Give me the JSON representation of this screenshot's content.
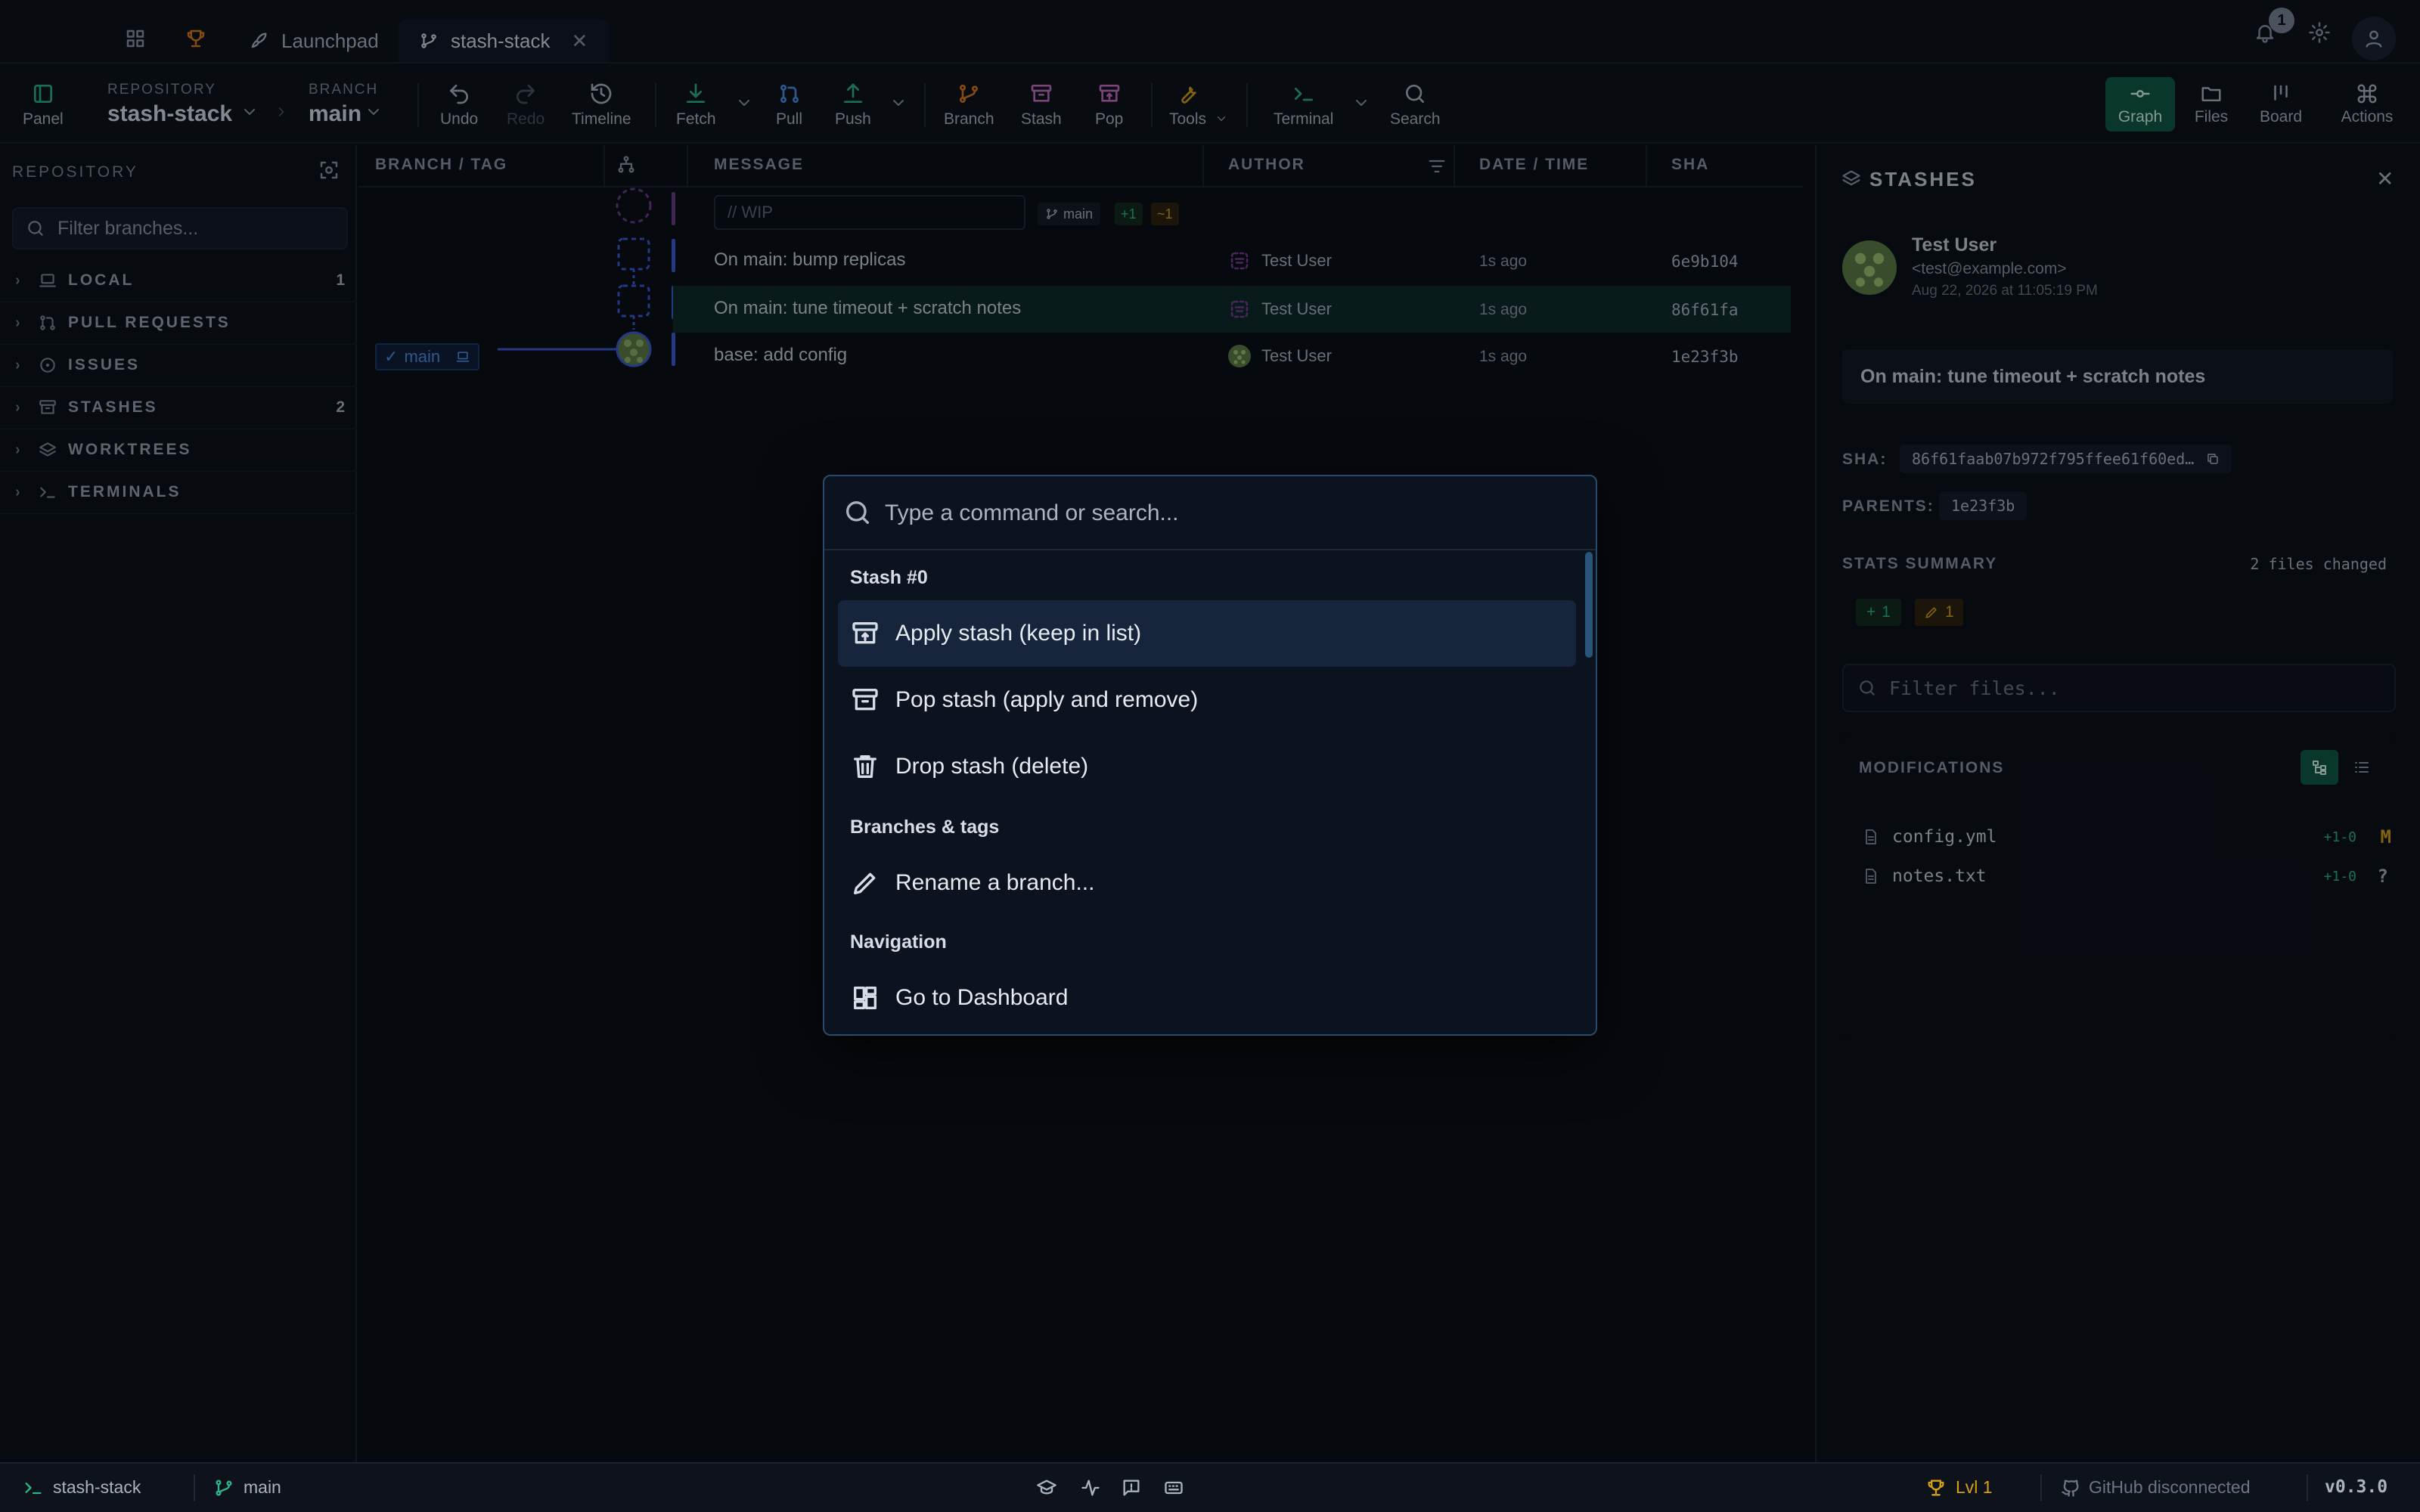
{
  "tabs": [
    {
      "label": "Launchpad"
    },
    {
      "label": "stash-stack"
    }
  ],
  "notifications": {
    "count": "1"
  },
  "toolbar": {
    "panel": "Panel",
    "repository_label": "REPOSITORY",
    "repository_value": "stash-stack",
    "branch_label": "BRANCH",
    "branch_value": "main",
    "undo": "Undo",
    "redo": "Redo",
    "timeline": "Timeline",
    "fetch": "Fetch",
    "pull": "Pull",
    "push": "Push",
    "branch": "Branch",
    "stash": "Stash",
    "pop": "Pop",
    "tools": "Tools",
    "terminal": "Terminal",
    "search": "Search",
    "views": {
      "graph": "Graph",
      "files": "Files",
      "board": "Board",
      "actions": "Actions"
    }
  },
  "sidebar": {
    "title": "REPOSITORY",
    "filter_placeholder": "Filter branches...",
    "items": [
      {
        "label": "LOCAL",
        "count": "1",
        "icon": "laptop-icon"
      },
      {
        "label": "PULL REQUESTS",
        "count": "",
        "icon": "pull-request-icon"
      },
      {
        "label": "ISSUES",
        "count": "",
        "icon": "issue-icon"
      },
      {
        "label": "STASHES",
        "count": "2",
        "icon": "archive-icon"
      },
      {
        "label": "WORKTREES",
        "count": "",
        "icon": "layers-icon"
      },
      {
        "label": "TERMINALS",
        "count": "",
        "icon": "terminal-icon"
      }
    ]
  },
  "graph": {
    "headers": {
      "branch_tag": "BRANCH / TAG",
      "message": "MESSAGE",
      "author": "AUTHOR",
      "datetime": "DATE / TIME",
      "sha": "SHA"
    },
    "wip": {
      "placeholder": "// WIP",
      "branch": "main",
      "added": "+1",
      "modified": "~1"
    },
    "rows": [
      {
        "message": "On main: bump replicas",
        "author": "Test User",
        "time": "1s ago",
        "sha": "6e9b104"
      },
      {
        "message": "On main: tune timeout + scratch notes",
        "author": "Test User",
        "time": "1s ago",
        "sha": "86f61fa"
      },
      {
        "message": "base: add config",
        "author": "Test User",
        "time": "1s ago",
        "sha": "1e23f3b"
      }
    ],
    "branch_label": "main"
  },
  "details": {
    "title": "STASHES",
    "author_name": "Test User",
    "author_email": "<test@example.com>",
    "date": "Aug 22, 2026 at 11:05:19 PM",
    "message": "On main: tune timeout + scratch notes",
    "sha_label": "SHA:",
    "sha_value": "86f61faab07b972f795ffee61f60ed…",
    "parents_label": "PARENTS:",
    "parents_value": "1e23f3b",
    "stats_label": "STATS SUMMARY",
    "files_changed": "2 files changed",
    "added": "1",
    "modified": "1",
    "filter_placeholder": "Filter files...",
    "modifications_label": "MODIFICATIONS",
    "files": [
      {
        "name": "config.yml",
        "diff": "+1-0",
        "status": "M"
      },
      {
        "name": "notes.txt",
        "diff": "+1-0",
        "status": "?"
      }
    ]
  },
  "palette": {
    "placeholder": "Type a command or search...",
    "groups": [
      {
        "label": "Stash #0",
        "items": [
          {
            "label": "Apply stash (keep in list)",
            "icon": "archive-upload-icon"
          },
          {
            "label": "Pop stash (apply and remove)",
            "icon": "archive-icon"
          },
          {
            "label": "Drop stash (delete)",
            "icon": "trash-icon"
          }
        ]
      },
      {
        "label": "Branches & tags",
        "items": [
          {
            "label": "Rename a branch...",
            "icon": "pencil-icon"
          }
        ]
      },
      {
        "label": "Navigation",
        "items": [
          {
            "label": "Go to Dashboard",
            "icon": "dashboard-icon"
          }
        ]
      }
    ]
  },
  "statusbar": {
    "repo": "stash-stack",
    "branch": "main",
    "level": "Lvl 1",
    "github": "GitHub disconnected",
    "version": "v0.3.0"
  },
  "colors": {
    "accent": "#0f5a47",
    "selection": "#16253b",
    "warning": "#d4a017"
  }
}
